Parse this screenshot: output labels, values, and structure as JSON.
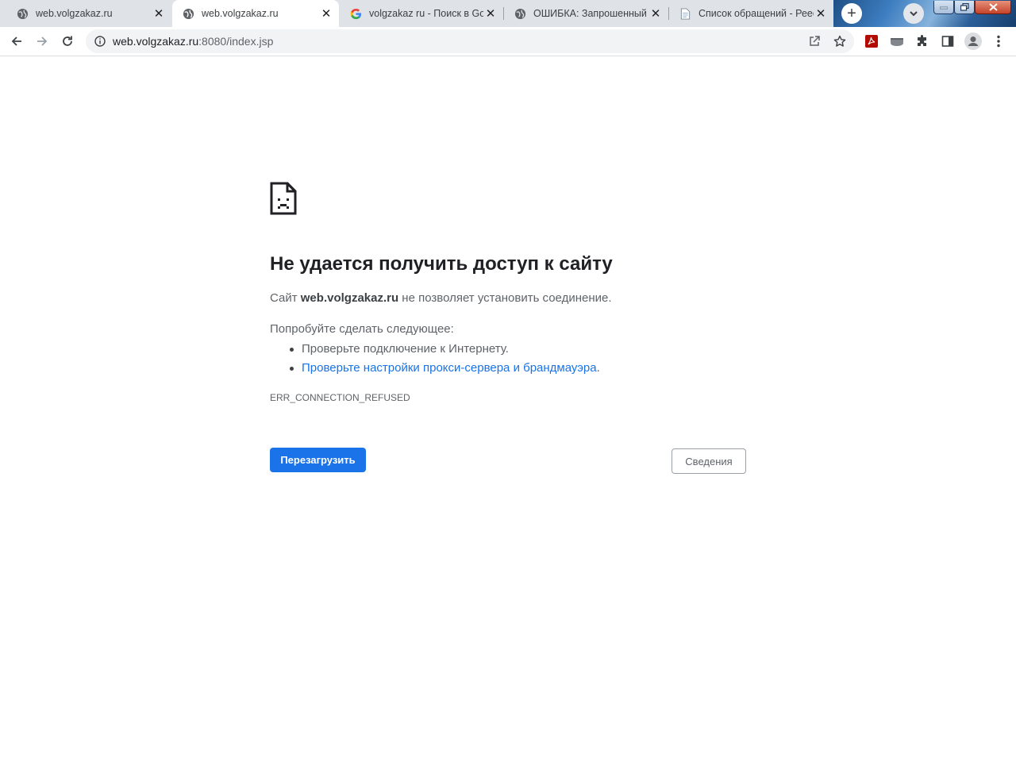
{
  "browser": {
    "tabs": [
      {
        "title": "web.volgzakaz.ru",
        "icon": "globe-icon",
        "active": false
      },
      {
        "title": "web.volgzakaz.ru",
        "icon": "globe-icon",
        "active": true
      },
      {
        "title": "volgzakaz ru - Поиск в Goo",
        "icon": "google-icon",
        "active": false
      },
      {
        "title": "ОШИБКА: Запрошенный U",
        "icon": "globe-icon",
        "active": false
      },
      {
        "title": "Список обращений - Реес",
        "icon": "document-icon",
        "active": false
      }
    ],
    "new_tab_symbol": "+",
    "close_symbol": "✕",
    "address": {
      "host": "web.volgzakaz.ru",
      "rest": ":8080/index.jsp"
    }
  },
  "error_page": {
    "title": "Не удается получить доступ к сайту",
    "line_prefix": "Сайт ",
    "site": "web.volgzakaz.ru",
    "line_suffix": " не позволяет установить соединение.",
    "try_heading": "Попробуйте сделать следующее:",
    "suggestions": [
      {
        "text": "Проверьте подключение к Интернету.",
        "link": false
      },
      {
        "text": "Проверьте настройки прокси-сервера и брандмауэра",
        "link": true,
        "trailing": "."
      }
    ],
    "error_code": "ERR_CONNECTION_REFUSED",
    "reload_label": "Перезагрузить",
    "details_label": "Сведения"
  },
  "colors": {
    "accent": "#1a73e8",
    "title": "#202124",
    "body_text": "#5f6368",
    "tab_strip": "#dfe3e8"
  }
}
